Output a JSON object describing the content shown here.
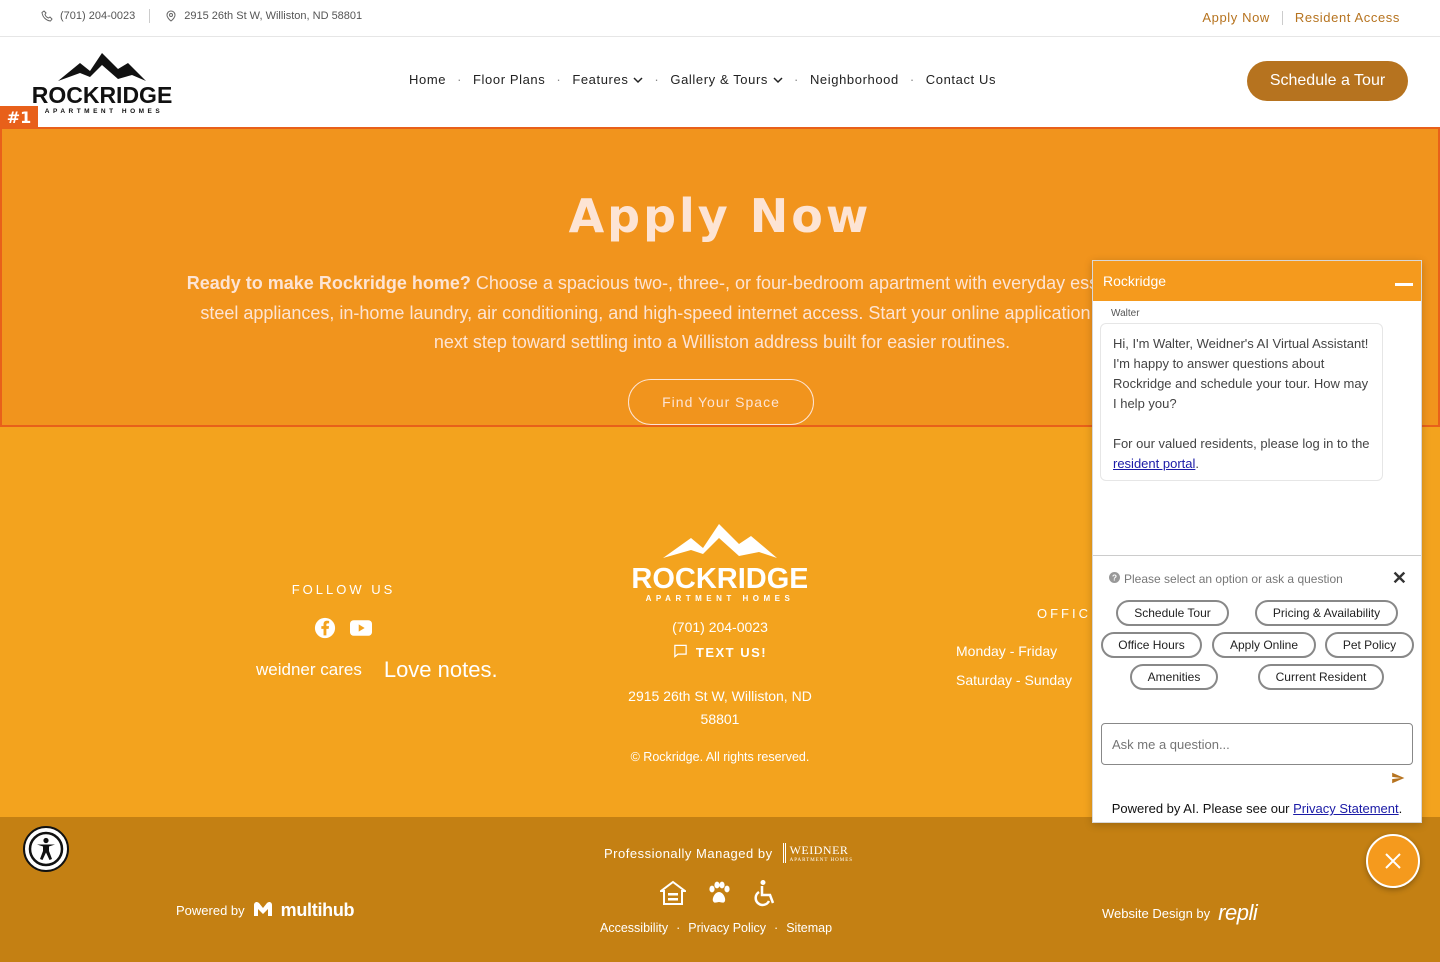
{
  "topbar": {
    "phone": "(701) 204-0023",
    "address": "2915 26th St W, Williston, ND 58801",
    "apply_now": "Apply Now",
    "resident_access": "Resident Access"
  },
  "header": {
    "logo_text": "ROCKRIDGE",
    "logo_sub": "APARTMENT HOMES",
    "nav": [
      {
        "label": "Home"
      },
      {
        "label": "Floor Plans"
      },
      {
        "label": "Features"
      },
      {
        "label": "Gallery & Tours"
      },
      {
        "label": "Neighborhood"
      },
      {
        "label": "Contact Us"
      }
    ],
    "schedule_tour": "Schedule a Tour"
  },
  "hero": {
    "tag": "#1",
    "title": "Apply Now",
    "lead_bold": "Ready to make Rockridge home?",
    "lead_text": " Choose a spacious two-, three-, or four-bedroom apartment with everyday essentials like stainless steel appliances, in-home laundry, air conditioning, and high-speed internet access. Start your online application today and take the next step toward settling into a Williston address built for easier routines.",
    "button": "Find Your Space"
  },
  "footer": {
    "follow_us": "FOLLOW US",
    "weidner_cares": "weidner cares",
    "love_notes": "Love notes.",
    "logo_text": "ROCKRIDGE",
    "logo_sub": "APARTMENT HOMES",
    "phone": "(701) 204-0023",
    "text_us": "TEXT US!",
    "address": "2915 26th St W, Williston, ND 58801",
    "copyright": "© Rockridge. All rights reserved.",
    "office": "OFFICE",
    "hours": [
      "Monday - Friday",
      "Saturday - Sunday"
    ]
  },
  "bottom": {
    "managed_by": "Professionally Managed by",
    "weidner": "WEIDNER",
    "weidner_sub": "APARTMENT HOMES",
    "links": [
      "Accessibility",
      "Privacy Policy",
      "Sitemap"
    ],
    "powered_by": "Powered by",
    "multihub": "multihub",
    "design_by": "Website Design by",
    "repli": "repli"
  },
  "chat": {
    "title": "Rockridge",
    "agent": "Walter",
    "greeting": "Hi, I'm Walter, Weidner's AI Virtual Assistant! I'm happy to answer questions about Rockridge and schedule your tour. How may I help you?",
    "resident_text": "For our valued residents, please log in to the",
    "resident_link": "resident portal",
    "prompt": "Please select an option or ask a question",
    "options": [
      "Schedule Tour",
      "Pricing & Availability",
      "Office Hours",
      "Apply Online",
      "Pet Policy",
      "Amenities",
      "Current Resident"
    ],
    "input_placeholder": "Ask me a question...",
    "footer_text": "Powered by AI. Please see our",
    "privacy_link": "Privacy Statement"
  },
  "colors": {
    "brand": "#b6731f",
    "hero_bg": "#f1941d",
    "footer_bg": "#f3a31e",
    "bottom_bg": "#c48013",
    "highlight": "#e8601a"
  }
}
